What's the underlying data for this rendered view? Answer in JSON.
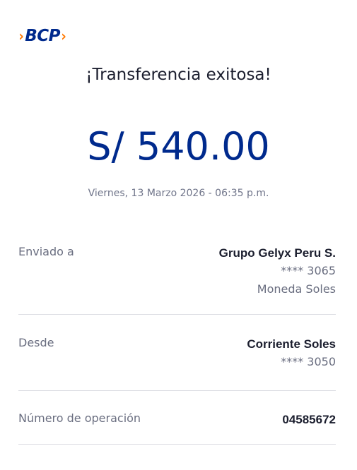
{
  "brand": {
    "name": "BCP",
    "chevron_left": "›",
    "chevron_right": "›",
    "primary_color": "#002a8d",
    "accent_color": "#ff7800"
  },
  "title": "¡Transferencia exitosa!",
  "amount": "S/ 540.00",
  "datetime": "Viernes, 13 Marzo 2026 - 06:35 p.m.",
  "details": {
    "recipient": {
      "label": "Enviado a",
      "name": "Grupo Gelyx Peru S.",
      "account": "**** 3065",
      "currency": "Moneda Soles"
    },
    "source": {
      "label": "Desde",
      "account_name": "Corriente Soles",
      "account": "**** 3050"
    },
    "operation": {
      "label": "Número de operación",
      "number": "04585672"
    }
  }
}
